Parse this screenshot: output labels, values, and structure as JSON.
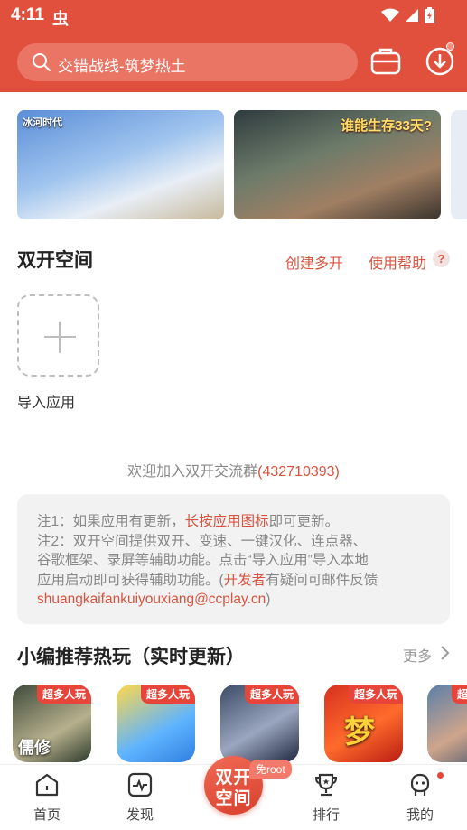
{
  "status_bar": {
    "time": "4:11",
    "app_glyph": "虫"
  },
  "search": {
    "text": "交错战线-筑梦热土"
  },
  "banners": [
    {
      "logo": "冰河时代",
      "title": "",
      "subtitle": ""
    },
    {
      "logo": "",
      "title": "谁能生存33天?",
      "subtitle": ""
    }
  ],
  "dual_space": {
    "title": "双开空间",
    "create_label": "创建多开",
    "help_label": "使用帮助",
    "help_badge": "?",
    "import_label": "导入应用"
  },
  "welcome": {
    "text": "欢迎加入双开交流群",
    "qq": "(432710393)"
  },
  "notes": {
    "line1_a": "注1：如果应用有更新，",
    "line1_b": "长按应用图标",
    "line1_c": "即可更新。",
    "line2": "注2：双开空间提供双开、变速、一键汉化、连点器、",
    "line3": "谷歌框架、录屏等辅助功能。点击“导入应用”导入本地",
    "line4_a": "应用启动即可获得辅助功能。(",
    "line4_b": "开发者",
    "line4_c": "有疑问可邮件反馈",
    "email": "shuangkaifankuiyouxiang@ccplay.cn",
    "close_paren": ")"
  },
  "recommend": {
    "title": "小编推荐热玩（实时更新）",
    "more_label": "更多",
    "games": [
      {
        "tag": "超多人玩",
        "art": "儒修"
      },
      {
        "tag": "超多人玩",
        "art": ""
      },
      {
        "tag": "超多人玩",
        "art": ""
      },
      {
        "tag": "超多人玩",
        "art": "梦"
      },
      {
        "tag": "超多人玩",
        "art": ""
      }
    ]
  },
  "nav": {
    "home": "首页",
    "discover": "发现",
    "center_line1": "双开",
    "center_line2": "空间",
    "root_badge": "免root",
    "rank": "排行",
    "mine": "我的"
  },
  "colors": {
    "brand": "#e0503d",
    "accent_text": "#d9533f",
    "tag": "#e8453a"
  }
}
